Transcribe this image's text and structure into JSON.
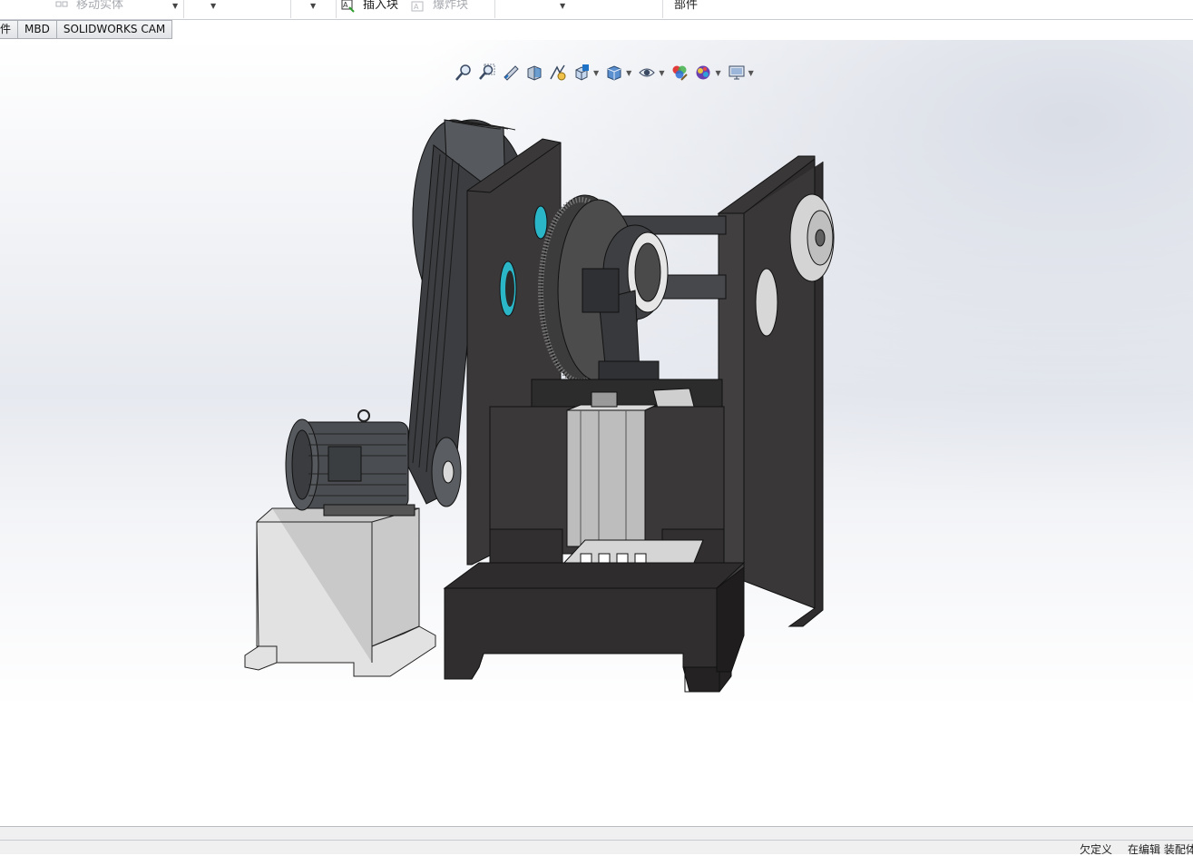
{
  "ribbon": {
    "move_body_label": "移动实体",
    "insert_block_label": "插入块",
    "explode_block_label": "爆炸块",
    "component_label": "部件"
  },
  "tabs": [
    {
      "label": "件"
    },
    {
      "label": "MBD"
    },
    {
      "label": "SOLIDWORKS CAM"
    }
  ],
  "heads_up_toolbar": {
    "icons": [
      "zoom-to-fit-icon",
      "zoom-to-area-icon",
      "previous-view-icon",
      "section-view-icon",
      "dynamic-annotation-icon",
      "view-orientation-icon",
      "display-style-icon",
      "hide-show-items-icon",
      "edit-appearance-icon",
      "apply-scene-icon",
      "view-settings-icon"
    ]
  },
  "colors": {
    "accent": "#1f73c7",
    "frame_dark": "#3b3938",
    "gear_dark": "#4a4a4a",
    "slide_grey": "#a9a9a9",
    "base_grey": "#d8d8d8",
    "cyan_bearing": "#2bb6c8"
  },
  "status": {
    "underdefined": "欠定义",
    "editing_assembly": "在编辑 装配体"
  }
}
